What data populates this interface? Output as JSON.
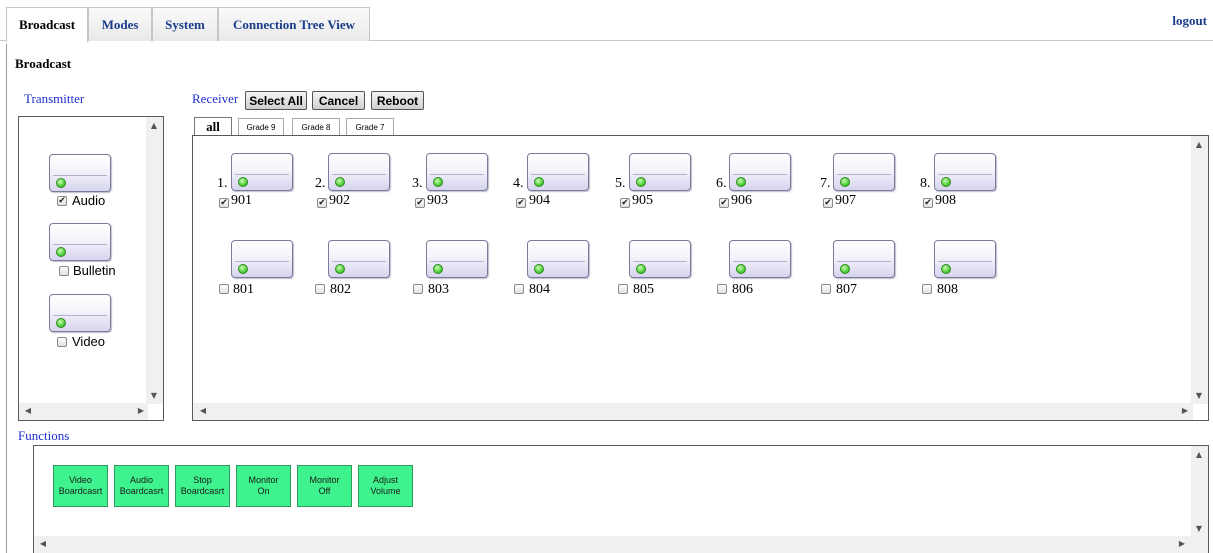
{
  "tabs": [
    {
      "label": "Broadcast"
    },
    {
      "label": "Modes"
    },
    {
      "label": "System"
    },
    {
      "label": "Connection Tree View"
    }
  ],
  "logout_label": "logout",
  "page_title": "Broadcast",
  "transmitter": {
    "label": "Transmitter",
    "items": [
      {
        "label": "Audio",
        "checked": true
      },
      {
        "label": "Bulletin",
        "checked": false
      },
      {
        "label": "Video",
        "checked": false
      }
    ]
  },
  "receiver": {
    "label": "Receiver",
    "buttons": {
      "select_all": "Select All",
      "cancel": "Cancel",
      "reboot": "Reboot"
    },
    "groups": [
      {
        "label": "all"
      },
      {
        "label": "Grade 9"
      },
      {
        "label": "Grade 8"
      },
      {
        "label": "Grade 7"
      }
    ],
    "row1": [
      {
        "num": "1.",
        "label": "901",
        "checked": true
      },
      {
        "num": "2.",
        "label": "902",
        "checked": true
      },
      {
        "num": "3.",
        "label": "903",
        "checked": true
      },
      {
        "num": "4.",
        "label": "904",
        "checked": true
      },
      {
        "num": "5.",
        "label": "905",
        "checked": true
      },
      {
        "num": "6.",
        "label": "906",
        "checked": true
      },
      {
        "num": "7.",
        "label": "907",
        "checked": true
      },
      {
        "num": "8.",
        "label": "908",
        "checked": true
      }
    ],
    "row2": [
      {
        "label": "801",
        "checked": false
      },
      {
        "label": "802",
        "checked": false
      },
      {
        "label": "803",
        "checked": false
      },
      {
        "label": "804",
        "checked": false
      },
      {
        "label": "805",
        "checked": false
      },
      {
        "label": "806",
        "checked": false
      },
      {
        "label": "807",
        "checked": false
      },
      {
        "label": "808",
        "checked": false
      }
    ]
  },
  "functions": {
    "label": "Functions",
    "buttons": [
      {
        "line1": "Video",
        "line2": "Boardcasrt"
      },
      {
        "line1": "Audio",
        "line2": "Boardcasrt"
      },
      {
        "line1": "Stop",
        "line2": "Boardcasrt"
      },
      {
        "line1": "Monitor",
        "line2": "On"
      },
      {
        "line1": "Monitor",
        "line2": "Off"
      },
      {
        "line1": "Adjust",
        "line2": "Volume"
      }
    ]
  },
  "icons": {
    "led": "status-led-icon",
    "scroll_up": "scroll-up-arrow-icon",
    "scroll_down": "scroll-down-arrow-icon",
    "scroll_left": "scroll-left-arrow-icon",
    "scroll_right": "scroll-right-arrow-icon"
  },
  "colors": {
    "tab_text": "#1a3d8a",
    "section_label": "#1f2fd0",
    "function_button": "#3ef28d",
    "led": "#3fc62a"
  }
}
